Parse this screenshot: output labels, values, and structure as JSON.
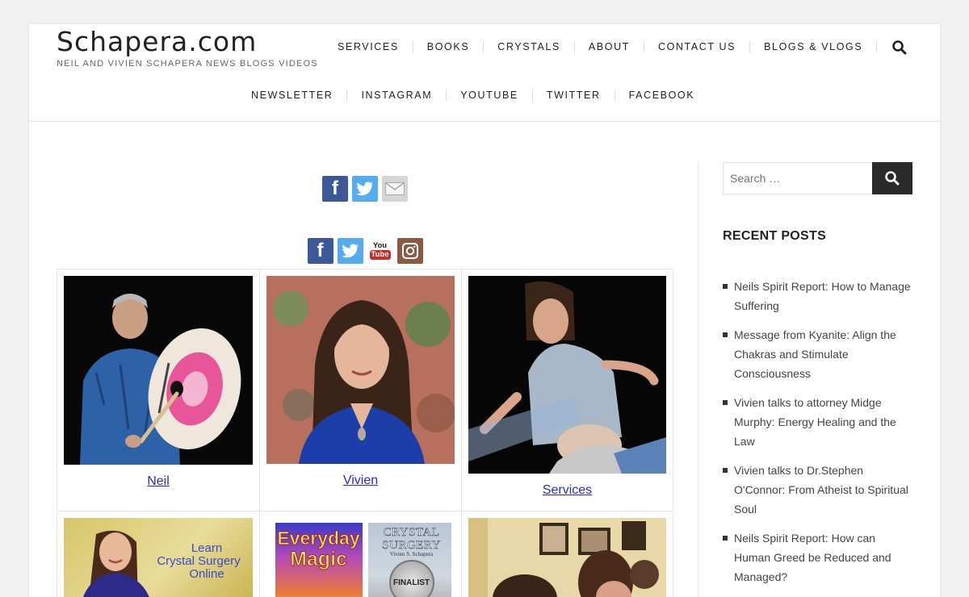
{
  "site": {
    "title": "Schapera.com",
    "tagline": "NEIL AND VIVIEN SCHAPERA NEWS BLOGS VIDEOS"
  },
  "nav": {
    "row1": [
      "SERVICES",
      "BOOKS",
      "CRYSTALS",
      "ABOUT",
      "CONTACT US",
      "BLOGS & VLOGS"
    ],
    "row2": [
      "NEWSLETTER",
      "INSTAGRAM",
      "YOUTUBE",
      "TWITTER",
      "FACEBOOK"
    ]
  },
  "icons": {
    "search": "search-icon",
    "facebook": "facebook-icon",
    "twitter": "twitter-icon",
    "email": "email-icon",
    "youtube": "youtube-icon",
    "instagram": "instagram-icon"
  },
  "youtube_logo": {
    "you": "You",
    "tube": "Tube"
  },
  "grid": {
    "cells": [
      {
        "label": "Neil"
      },
      {
        "label": "Vivien"
      },
      {
        "label": "Services"
      }
    ],
    "promo": {
      "learn": "Learn",
      "crystal": "Crystal Surgery",
      "online": "Online"
    },
    "books": {
      "book1_line1": "Everyday",
      "book1_line2": "Magic",
      "book2_line1": "CRYSTAL",
      "book2_line2": "SURGERY",
      "book2_author": "Vivien S. Schapera",
      "book2_badge": "FINALIST"
    }
  },
  "sidebar": {
    "search_placeholder": "Search …",
    "recent_title": "RECENT POSTS",
    "posts": [
      "Neils Spirit Report: How to Manage Suffering",
      "Message from Kyanite: Align the Chakras and Stimulate Consciousness",
      "Vivien talks to attorney Midge Murphy: Energy Healing and the Law",
      "Vivien talks to Dr.Stephen O'Connor: From Atheist to Spiritual Soul",
      "Neils Spirit Report: How can Human Greed be Reduced and Managed?"
    ]
  },
  "colors": {
    "facebook": "#3b5998",
    "twitter": "#55acee",
    "instagram": "#8a5a44",
    "youtube_red": "#c4302b",
    "link": "#2a2ad0",
    "search_button": "#2a2a2a"
  }
}
